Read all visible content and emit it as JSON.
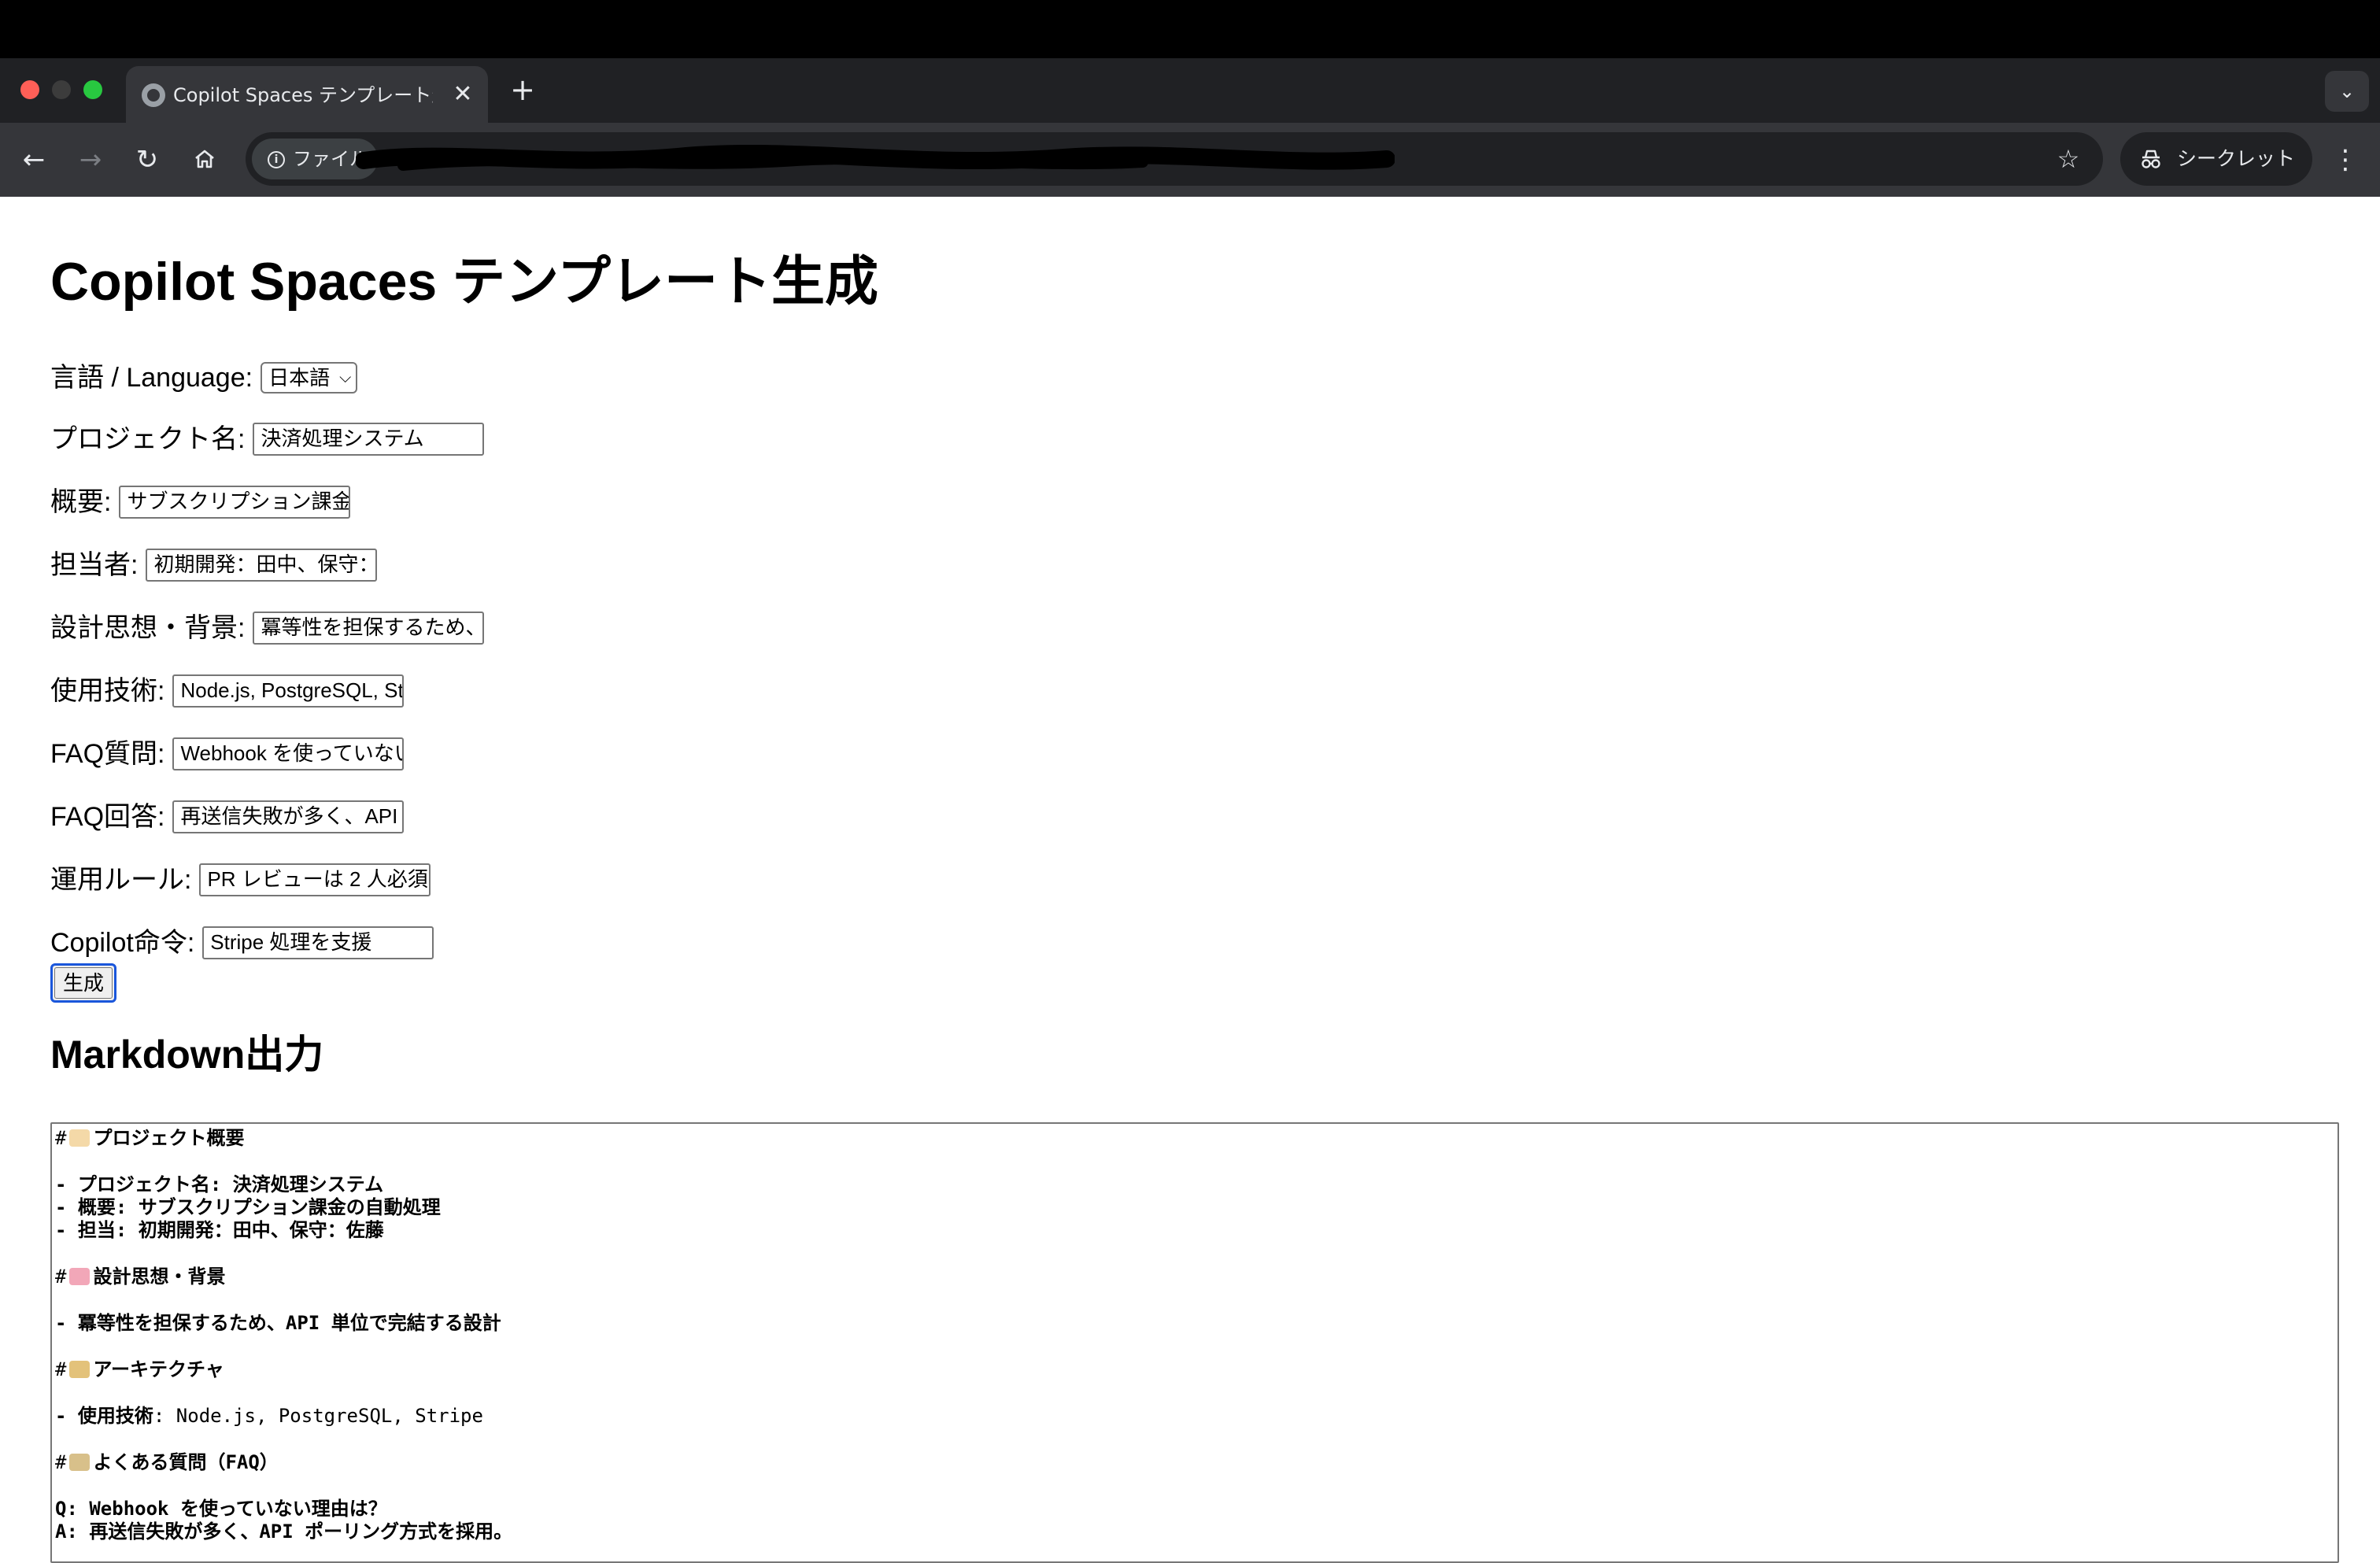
{
  "browser": {
    "tab_title": "Copilot Spaces テンプレート生成",
    "tab_close": "✕",
    "new_tab": "+",
    "tab_menu": "⌄",
    "back": "←",
    "forward": "→",
    "reload": "↻",
    "site_label": "ファイル",
    "info": "i",
    "star": "☆",
    "incognito_label": "シークレット",
    "menu": "⋮"
  },
  "page": {
    "title": "Copilot Spaces テンプレート生成",
    "language_label": "言語 / Language:",
    "language_value": "日本語",
    "fields": [
      {
        "label": "プロジェクト名:",
        "value": "決済処理システム"
      },
      {
        "label": "概要:",
        "value": "サブスクリプション課金の自動処理"
      },
      {
        "label": "担当者:",
        "value": "初期開発：田中、保守：佐藤"
      },
      {
        "label": "設計思想・背景:",
        "value": "冪等性を担保するため、API 単位で完結する設計"
      },
      {
        "label": "使用技術:",
        "value": "Node.js, PostgreSQL, Stripe"
      },
      {
        "label": "FAQ質問:",
        "value": "Webhook を使っていない理由は？"
      },
      {
        "label": "FAQ回答:",
        "value": "再送信失敗が多く、API ポーリング方式を採用。"
      },
      {
        "label": "運用ルール:",
        "value": "PR レビューは 2 人必須"
      },
      {
        "label": "Copilot命令:",
        "value": "Stripe 処理を支援"
      }
    ],
    "generate_button": "生成",
    "markdown_heading": "Markdown出力",
    "markdown": {
      "h_overview_hash": "#",
      "h_overview": "プロジェクト概要",
      "overview_lines": [
        "- プロジェクト名: 決済処理システム",
        "- 概要: サブスクリプション課金の自動処理",
        "- 担当: 初期開発：田中、保守：佐藤"
      ],
      "h_design_hash": "#",
      "h_design": "設計思想・背景",
      "design_line": "- 冪等性を担保するため、API 単位で完結する設計",
      "h_arch_hash": "#",
      "h_arch": "アーキテクチャ",
      "arch_line_prefix": "- 使用技術",
      "arch_line_value": ": Node.js, PostgreSQL, Stripe",
      "h_faq_hash": "#",
      "h_faq": "よくある質問（FAQ）",
      "faq_q": "Q: Webhook を使っていない理由は？",
      "faq_a": "A: 再送信失敗が多く、API ポーリング方式を採用。"
    },
    "icons": {
      "overview": "label-tag-icon",
      "design": "brain-icon",
      "architecture": "building-icon",
      "faq": "memo-icon"
    }
  },
  "colors": {
    "tab_bg": "#35363a",
    "chrome_dark": "#202124",
    "focus_ring": "#1a56db"
  }
}
